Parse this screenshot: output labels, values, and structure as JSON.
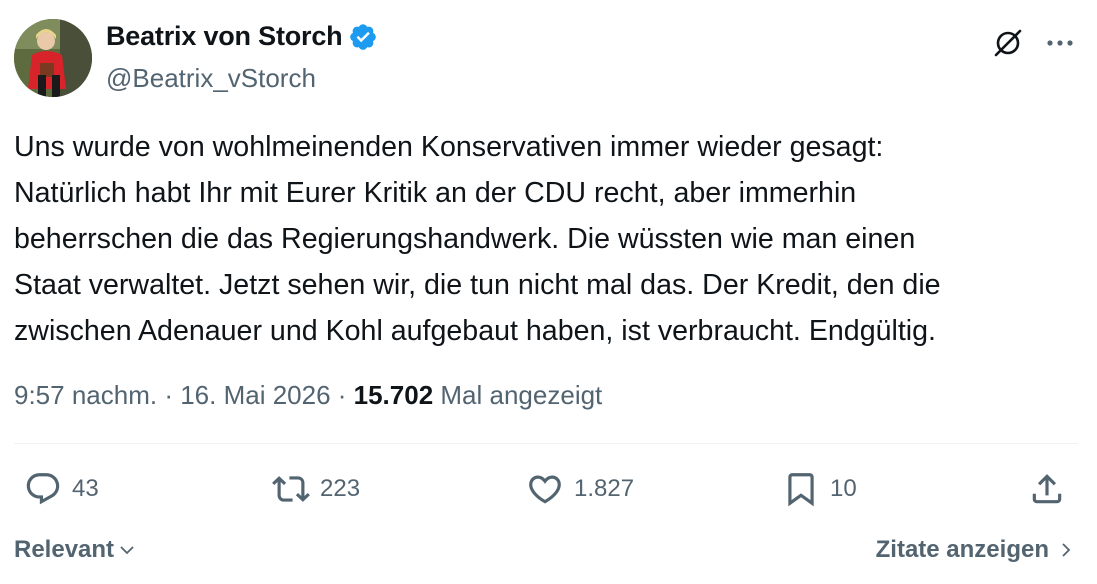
{
  "author": {
    "name": "Beatrix von Storch",
    "handle": "@Beatrix_vStorch",
    "verified": true
  },
  "icons": {
    "verified": "verified-badge-icon",
    "grok": "grok-icon",
    "more": "more-options-icon",
    "reply": "reply-icon",
    "retweet": "retweet-icon",
    "like": "like-icon",
    "bookmark": "bookmark-icon",
    "share": "share-icon"
  },
  "tweet": {
    "lines": [
      "Uns wurde von wohlmeinenden Konservativen immer wieder gesagt:",
      "Natürlich habt Ihr mit Eurer Kritik an der CDU recht, aber immerhin",
      "beherrschen die das Regierungshandwerk. Die wüssten wie man einen",
      "Staat verwaltet. Jetzt sehen wir, die tun nicht mal das. Der Kredit, den die",
      "zwischen Adenauer und Kohl aufgebaut haben, ist verbraucht. Endgültig."
    ]
  },
  "meta": {
    "time": "9:57 nachm.",
    "separator": " · ",
    "date": "16. Mai 2026",
    "views_count": "15.702",
    "views_label": " Mal angezeigt"
  },
  "actions": {
    "replies": "43",
    "retweets": "223",
    "likes": "1.827",
    "bookmarks": "10"
  },
  "footer": {
    "sort_label": "Relevant",
    "quotes_label": "Zitate anzeigen"
  },
  "colors": {
    "text_primary": "#0f1419",
    "text_secondary": "#536471",
    "verified_blue": "#1d9bf0",
    "divider": "#eff3f4"
  }
}
